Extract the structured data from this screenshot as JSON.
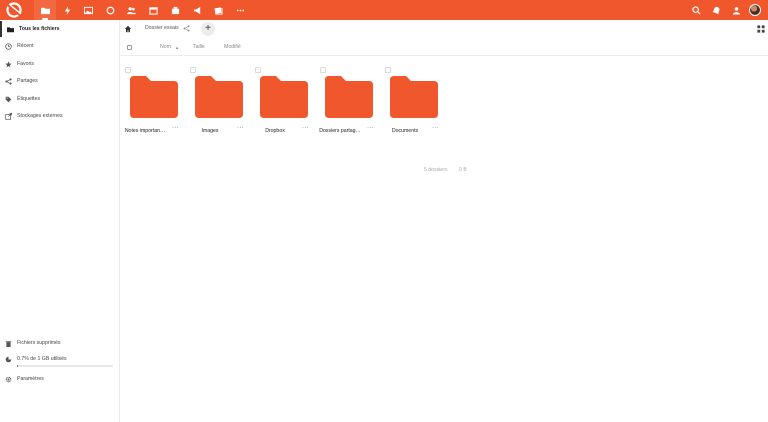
{
  "header": {
    "apps": [
      {
        "icon": "files-icon"
      },
      {
        "icon": "activity-icon"
      },
      {
        "icon": "photos-icon"
      },
      {
        "icon": "search-circle-icon"
      },
      {
        "icon": "contacts-icon"
      },
      {
        "icon": "calendar-icon"
      },
      {
        "icon": "deck-icon"
      },
      {
        "icon": "announcements-icon"
      },
      {
        "icon": "notes-icon"
      },
      {
        "icon": "more-apps-icon"
      }
    ],
    "accent": "#f0572c"
  },
  "sidebar": {
    "items": [
      {
        "label": "Tous les fichiers",
        "icon": "folder-icon"
      },
      {
        "label": "Récent",
        "icon": "clock-icon"
      },
      {
        "label": "Favoris",
        "icon": "star-icon"
      },
      {
        "label": "Partages",
        "icon": "share-icon"
      },
      {
        "label": "Étiquettes",
        "icon": "tag-icon"
      },
      {
        "label": "Stockages externes",
        "icon": "external-icon"
      }
    ],
    "bottom": {
      "deleted": "Fichiers supprimés",
      "quota": "0.7% de 1 GB utilisés",
      "quota_fraction": 0.007,
      "settings": "Paramètres"
    }
  },
  "breadcrumb": {
    "current": "Dossier essais"
  },
  "table": {
    "col_name": "Nom",
    "sort_arrow": "▲",
    "col_size": "Taille",
    "col_modified": "Modifié"
  },
  "files": [
    {
      "name": "Notes importan…",
      "more": "···"
    },
    {
      "name": "Images",
      "more": "···"
    },
    {
      "name": "Dropbox",
      "more": "···"
    },
    {
      "name": "Dossiers partag…",
      "more": "···"
    },
    {
      "name": "Documents",
      "more": "···"
    }
  ],
  "summary": {
    "count": "5 dossiers",
    "size": "0 B"
  }
}
